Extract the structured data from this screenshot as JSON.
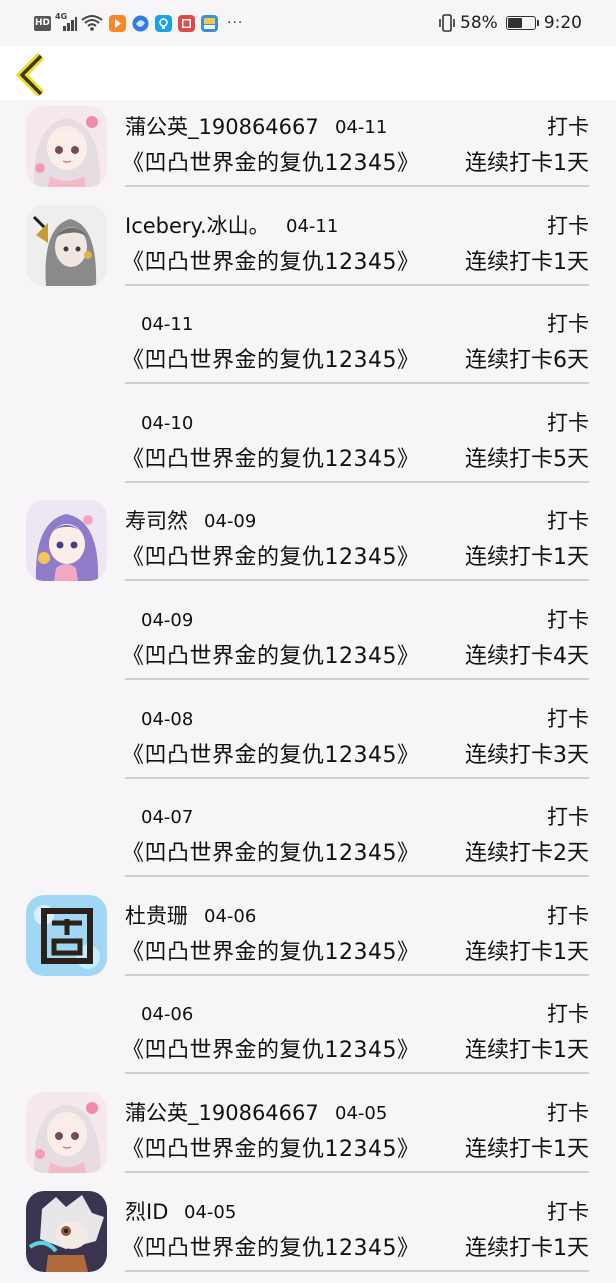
{
  "status_bar": {
    "hd": "HD",
    "network": "4G",
    "battery_percent": "58%",
    "battery_level": 0.58,
    "time": "9:20",
    "more": "···"
  },
  "nav": {
    "back_icon": "chevron-left-icon"
  },
  "records": [
    {
      "avatar": "girl-white-hair",
      "name": "蒲公英_190864667",
      "date": "04-11",
      "action": "打卡",
      "book": "《凹凸世界金的复仇12345》",
      "streak": "连续打卡1天"
    },
    {
      "avatar": "girl-gray-hair",
      "name": "Icebery.冰山。",
      "date": "04-11",
      "action": "打卡",
      "book": "《凹凸世界金的复仇12345》",
      "streak": "连续打卡1天"
    },
    {
      "avatar": "",
      "name": "",
      "date": "04-11",
      "action": "打卡",
      "book": "《凹凸世界金的复仇12345》",
      "streak": "连续打卡6天"
    },
    {
      "avatar": "",
      "name": "",
      "date": "04-10",
      "action": "打卡",
      "book": "《凹凸世界金的复仇12345》",
      "streak": "连续打卡5天"
    },
    {
      "avatar": "girl-purple-hair",
      "name": "寿司然",
      "date": "04-09",
      "action": "打卡",
      "book": "《凹凸世界金的复仇12345》",
      "streak": "连续打卡1天"
    },
    {
      "avatar": "",
      "name": "",
      "date": "04-09",
      "action": "打卡",
      "book": "《凹凸世界金的复仇12345》",
      "streak": "连续打卡4天"
    },
    {
      "avatar": "",
      "name": "",
      "date": "04-08",
      "action": "打卡",
      "book": "《凹凸世界金的复仇12345》",
      "streak": "连续打卡3天"
    },
    {
      "avatar": "",
      "name": "",
      "date": "04-07",
      "action": "打卡",
      "book": "《凹凸世界金的复仇12345》",
      "streak": "连续打卡2天"
    },
    {
      "avatar": "blue-glyph",
      "name": "杜贵珊",
      "date": "04-06",
      "action": "打卡",
      "book": "《凹凸世界金的复仇12345》",
      "streak": "连续打卡1天"
    },
    {
      "avatar": "",
      "name": "",
      "date": "04-06",
      "action": "打卡",
      "book": "《凹凸世界金的复仇12345》",
      "streak": "连续打卡1天"
    },
    {
      "avatar": "girl-white-hair",
      "name": "蒲公英_190864667",
      "date": "04-05",
      "action": "打卡",
      "book": "《凹凸世界金的复仇12345》",
      "streak": "连续打卡1天"
    },
    {
      "avatar": "white-hair-character",
      "name": "烈ID",
      "date": "04-05",
      "action": "打卡",
      "book": "《凹凸世界金的复仇12345》",
      "streak": "连续打卡1天"
    }
  ]
}
